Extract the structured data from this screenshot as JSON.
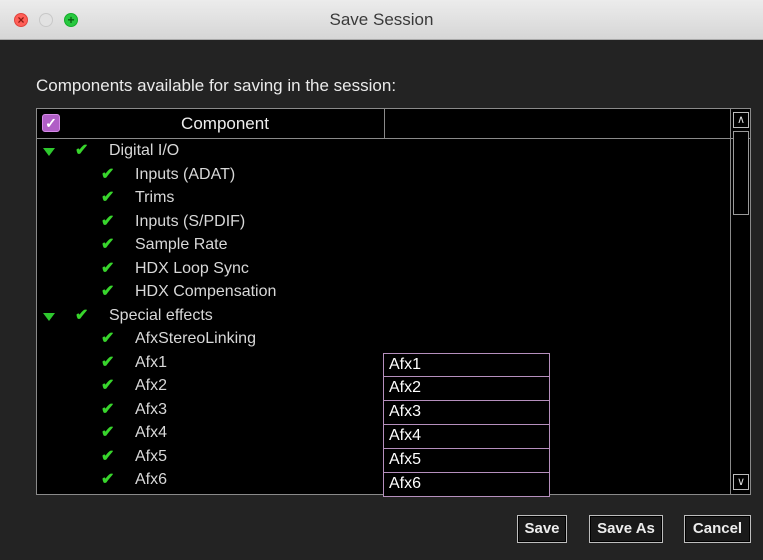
{
  "window": {
    "title": "Save Session",
    "close_glyph": "×",
    "zoom_glyph": "+"
  },
  "heading": "Components available for saving in the session:",
  "table": {
    "header_check_glyph": "✓",
    "column_header": "Component",
    "second_column_header": "",
    "rows": [
      {
        "label": "Digital I/O",
        "level": 0,
        "expanded": true,
        "checked": true
      },
      {
        "label": "Inputs (ADAT)",
        "level": 1,
        "checked": true
      },
      {
        "label": "Trims",
        "level": 1,
        "checked": true
      },
      {
        "label": "Inputs (S/PDIF)",
        "level": 1,
        "checked": true
      },
      {
        "label": "Sample Rate",
        "level": 1,
        "checked": true
      },
      {
        "label": "HDX Loop Sync",
        "level": 1,
        "checked": true
      },
      {
        "label": "HDX Compensation",
        "level": 1,
        "checked": true
      },
      {
        "label": "Special effects",
        "level": 0,
        "expanded": true,
        "checked": true
      },
      {
        "label": "AfxStereoLinking",
        "level": 1,
        "checked": true
      },
      {
        "label": "Afx1",
        "level": 1,
        "checked": true
      },
      {
        "label": "Afx2",
        "level": 1,
        "checked": true
      },
      {
        "label": "Afx3",
        "level": 1,
        "checked": true
      },
      {
        "label": "Afx4",
        "level": 1,
        "checked": true
      },
      {
        "label": "Afx5",
        "level": 1,
        "checked": true
      },
      {
        "label": "Afx6",
        "level": 1,
        "checked": true
      }
    ],
    "name_fields": [
      "Afx1",
      "Afx2",
      "Afx3",
      "Afx4",
      "Afx5",
      "Afx6"
    ],
    "check_glyph": "✔",
    "scroll_up_glyph": "∧",
    "scroll_down_glyph": "∨"
  },
  "buttons": {
    "save": "Save",
    "save_as": "Save As",
    "cancel": "Cancel"
  },
  "colors": {
    "accent_check": "#38d52c",
    "header_checkbox": "#b05ec6",
    "field_border": "#b58fbd"
  },
  "icons": [
    "close-icon",
    "minimize-icon",
    "zoom-icon",
    "checkmark-icon",
    "disclosure-triangle-icon",
    "scroll-up-icon",
    "scroll-down-icon"
  ]
}
